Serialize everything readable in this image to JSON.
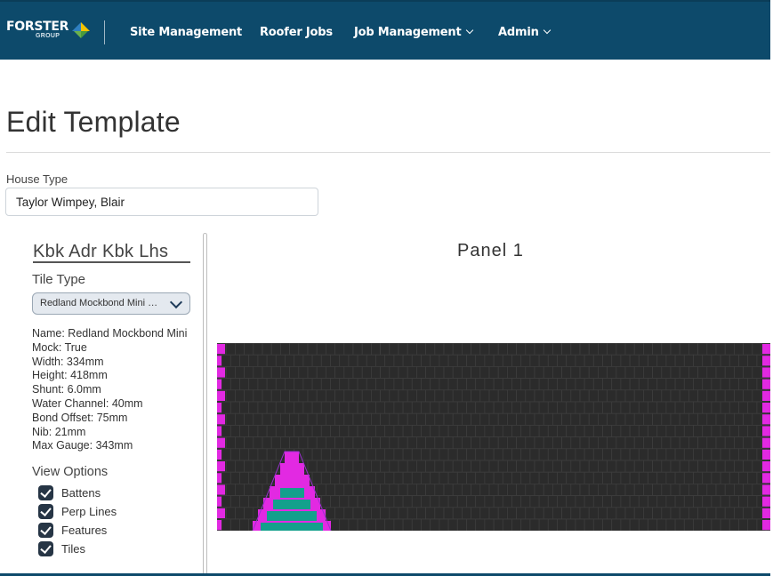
{
  "nav": {
    "brand_name": "FORSTER",
    "brand_sub": "GROUP",
    "items": [
      {
        "label": "Site Management",
        "dropdown": false
      },
      {
        "label": "Roofer Jobs",
        "dropdown": false
      },
      {
        "label": "Job Management",
        "dropdown": true
      },
      {
        "label": "Admin",
        "dropdown": true
      }
    ]
  },
  "page": {
    "title": "Edit Template",
    "house_type_label": "House Type",
    "house_type_value": "Taylor Wimpey, Blair"
  },
  "sidebar": {
    "template_name": "Kbk Adr Kbk Lhs",
    "tile_type_label": "Tile Type",
    "tile_type_selected": "Redland Mockbond Mini Redland Mockbond Mini",
    "properties": [
      "Name: Redland Mockbond Mini",
      "Mock: True",
      "Width: 334mm",
      "Height: 418mm",
      "Shunt: 6.0mm",
      "Water Channel: 40mm",
      "Bond Offset: 75mm",
      "Nib: 21mm",
      "Max Gauge: 343mm"
    ],
    "view_options_label": "View Options",
    "view_options": [
      {
        "label": "Battens",
        "checked": true
      },
      {
        "label": "Perp Lines",
        "checked": true
      },
      {
        "label": "Features",
        "checked": true
      },
      {
        "label": "Tiles",
        "checked": true
      }
    ]
  },
  "panel": {
    "title": "Panel 1",
    "colors": {
      "tile": "#2b2b2b",
      "tile_line": "#3d3d3d",
      "edge_tile": "#e229e2",
      "feature_fill": "#13a08c",
      "outline": "#9b2fd0"
    }
  },
  "colors": {
    "navbar": "#0d4a6b",
    "logo_blue": "#2f7fc0",
    "logo_yellow": "#f2c200",
    "logo_green": "#6ab04c",
    "checkbox": "#263545"
  }
}
